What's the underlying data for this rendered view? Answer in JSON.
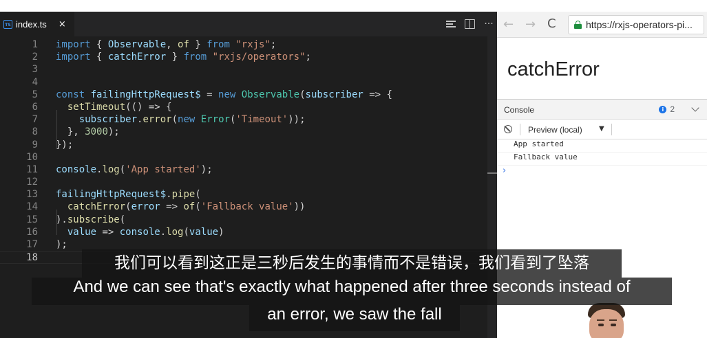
{
  "editor": {
    "tab": {
      "icon": "typescript-file-icon",
      "icon_text": "TS",
      "label": "index.ts",
      "close": "×"
    },
    "actions": [
      "outline-icon",
      "split-editor-icon",
      "more-icon"
    ],
    "more_label": "···",
    "lines": [
      {
        "n": "1",
        "tokens": [
          [
            "kw",
            "import"
          ],
          [
            "pun",
            " { "
          ],
          [
            "var",
            "Observable"
          ],
          [
            "pun",
            ", "
          ],
          [
            "fn",
            "of"
          ],
          [
            "pun",
            " } "
          ],
          [
            "kw",
            "from"
          ],
          [
            "pun",
            " "
          ],
          [
            "str",
            "\"rxjs\""
          ],
          [
            "pun",
            ";"
          ]
        ]
      },
      {
        "n": "2",
        "tokens": [
          [
            "kw",
            "import"
          ],
          [
            "pun",
            " { "
          ],
          [
            "var",
            "catchError"
          ],
          [
            "pun",
            " } "
          ],
          [
            "kw",
            "from"
          ],
          [
            "pun",
            " "
          ],
          [
            "str",
            "\"rxjs/operators\""
          ],
          [
            "pun",
            ";"
          ]
        ]
      },
      {
        "n": "3",
        "tokens": []
      },
      {
        "n": "4",
        "tokens": []
      },
      {
        "n": "5",
        "tokens": [
          [
            "kw",
            "const"
          ],
          [
            "pun",
            " "
          ],
          [
            "var",
            "failingHttpRequest$"
          ],
          [
            "pun",
            " = "
          ],
          [
            "kw",
            "new"
          ],
          [
            "pun",
            " "
          ],
          [
            "cls",
            "Observable"
          ],
          [
            "pun",
            "("
          ],
          [
            "var",
            "subscriber"
          ],
          [
            "pun",
            " => {"
          ]
        ]
      },
      {
        "n": "6",
        "tokens": [
          [
            "pun",
            "  "
          ],
          [
            "fn",
            "setTimeout"
          ],
          [
            "pun",
            "(() => {"
          ]
        ]
      },
      {
        "n": "7",
        "tokens": [
          [
            "pun",
            "    "
          ],
          [
            "var",
            "subscriber"
          ],
          [
            "pun",
            "."
          ],
          [
            "fn",
            "error"
          ],
          [
            "pun",
            "("
          ],
          [
            "kw",
            "new"
          ],
          [
            "pun",
            " "
          ],
          [
            "cls",
            "Error"
          ],
          [
            "pun",
            "("
          ],
          [
            "str",
            "'Timeout'"
          ],
          [
            "pun",
            "));"
          ]
        ]
      },
      {
        "n": "8",
        "tokens": [
          [
            "pun",
            "  }, "
          ],
          [
            "num",
            "3000"
          ],
          [
            "pun",
            ");"
          ]
        ]
      },
      {
        "n": "9",
        "tokens": [
          [
            "pun",
            "});"
          ]
        ]
      },
      {
        "n": "10",
        "tokens": []
      },
      {
        "n": "11",
        "tokens": [
          [
            "var",
            "console"
          ],
          [
            "pun",
            "."
          ],
          [
            "fn",
            "log"
          ],
          [
            "pun",
            "("
          ],
          [
            "str",
            "'App started'"
          ],
          [
            "pun",
            ");"
          ]
        ]
      },
      {
        "n": "12",
        "tokens": []
      },
      {
        "n": "13",
        "tokens": [
          [
            "var",
            "failingHttpRequest$"
          ],
          [
            "pun",
            "."
          ],
          [
            "fn",
            "pipe"
          ],
          [
            "pun",
            "("
          ]
        ]
      },
      {
        "n": "14",
        "tokens": [
          [
            "pun",
            "  "
          ],
          [
            "fn",
            "catchError"
          ],
          [
            "pun",
            "("
          ],
          [
            "var",
            "error"
          ],
          [
            "pun",
            " => "
          ],
          [
            "fn",
            "of"
          ],
          [
            "pun",
            "("
          ],
          [
            "str",
            "'Fallback value'"
          ],
          [
            "pun",
            "))"
          ]
        ]
      },
      {
        "n": "15",
        "tokens": [
          [
            "pun",
            ")."
          ],
          [
            "fn",
            "subscribe"
          ],
          [
            "pun",
            "("
          ]
        ]
      },
      {
        "n": "16",
        "tokens": [
          [
            "pun",
            "  "
          ],
          [
            "var",
            "value"
          ],
          [
            "pun",
            " => "
          ],
          [
            "var",
            "console"
          ],
          [
            "pun",
            "."
          ],
          [
            "fn",
            "log"
          ],
          [
            "pun",
            "("
          ],
          [
            "var",
            "value"
          ],
          [
            "pun",
            ")"
          ]
        ]
      },
      {
        "n": "17",
        "tokens": [
          [
            "pun",
            ");"
          ]
        ]
      },
      {
        "n": "18",
        "tokens": []
      }
    ],
    "current_line": "18"
  },
  "browser": {
    "back": "←",
    "forward": "→",
    "reload": "C",
    "url": "https://rxjs-operators-pi...",
    "page_title": "catchError",
    "console": {
      "tab": "Console",
      "info_icon_text": "i",
      "info_count": "2",
      "context": "Preview (local)",
      "context_arrow": "▼",
      "messages": [
        "App started",
        "Fallback value"
      ],
      "prompt": "›"
    }
  },
  "subtitles": {
    "zh": "我们可以看到这正是三秒后发生的事情而不是错误，我们看到了坠落",
    "en_line1": "And we can see that's exactly what happened after three seconds instead of",
    "en_line2": "an error, we saw the fall"
  },
  "colors": {
    "editor_bg": "#1e1e1e",
    "keyword": "#569cd6",
    "string": "#ce9178",
    "variable": "#9cdcfe",
    "function": "#dcdcaa",
    "class": "#4ec9b0",
    "number": "#b5cea8",
    "secure_lock": "#1e8e3e",
    "info_badge": "#1a73e8"
  }
}
